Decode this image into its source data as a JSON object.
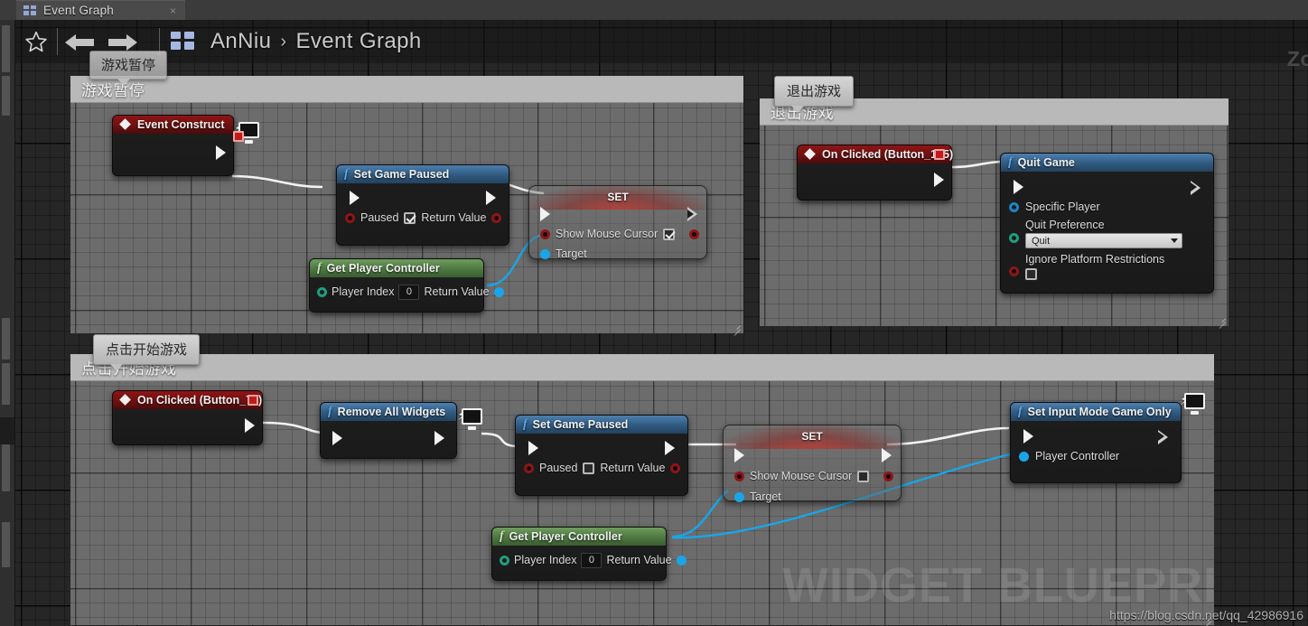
{
  "window": {
    "tab_label": "Event Graph",
    "tab_close": "×",
    "tab_icon": "graph-icon"
  },
  "toolbar": {
    "star_icon": "favorite-star-icon",
    "back_icon": "back-arrow-icon",
    "forward_icon": "forward-arrow-icon",
    "graph_icon": "event-graph-icon",
    "breadcrumb_root": "AnNiu",
    "breadcrumb_chevron": "›",
    "breadcrumb_leaf": "Event Graph",
    "zoom_label": "Zo"
  },
  "tooltips": {
    "pause": "游戏暂停",
    "quit": "退出游戏",
    "start": "点击开始游戏"
  },
  "comments": {
    "pause": "游戏暂停",
    "quit": "退出游戏",
    "start": "点击开始游戏"
  },
  "nodes": {
    "event_construct": {
      "title": "Event Construct",
      "icon": "event-diamond-icon",
      "badge": "monitor-icon",
      "exec_out": "exec-output-pin"
    },
    "set_game_paused_top": {
      "title": "Set Game Paused",
      "icon": "function-f-icon",
      "input_label": "Paused",
      "input_checked": true,
      "output_label": "Return Value"
    },
    "set_top": {
      "title": "SET",
      "input_label": "Show Mouse Cursor",
      "input_checked": true,
      "target_label": "Target"
    },
    "get_player_controller_top": {
      "title": "Get Player Controller",
      "icon": "function-f-icon",
      "input_label": "Player Index",
      "input_value": "0",
      "output_label": "Return Value"
    },
    "on_clicked_155": {
      "title": "On Clicked (Button_155)",
      "icon": "event-diamond-icon"
    },
    "quit_game": {
      "title": "Quit Game",
      "icon": "function-f-icon",
      "specific_player": "Specific Player",
      "quit_preference_label": "Quit Preference",
      "quit_preference_value": "Quit",
      "ignore_label": "Ignore Platform Restrictions",
      "ignore_checked": false
    },
    "on_clicked_77": {
      "title": "On Clicked (Button_77)",
      "icon": "event-diamond-icon"
    },
    "remove_all_widgets": {
      "title": "Remove All Widgets",
      "icon": "function-f-icon",
      "badge": "monitor-icon"
    },
    "set_game_paused_bottom": {
      "title": "Set Game Paused",
      "icon": "function-f-icon",
      "input_label": "Paused",
      "input_checked": false,
      "output_label": "Return Value"
    },
    "set_bottom": {
      "title": "SET",
      "input_label": "Show Mouse Cursor",
      "input_checked": false,
      "target_label": "Target"
    },
    "get_player_controller_bottom": {
      "title": "Get Player Controller",
      "icon": "function-f-icon",
      "input_label": "Player Index",
      "input_value": "0",
      "output_label": "Return Value"
    },
    "set_input_mode": {
      "title": "Set Input Mode Game Only",
      "icon": "function-f-icon",
      "badge": "monitor-icon",
      "player_controller_label": "Player Controller"
    }
  },
  "overlay": {
    "watermark": "WIDGET BLUEPRI",
    "url": "https://blog.csdn.net/qq_42986916"
  },
  "colors": {
    "event_red": "#8e1414",
    "function_blue": "#4d7fae",
    "pure_green": "#6f9c5e",
    "exec_wire": "#f2f2f2",
    "object_wire": "#19a6e8",
    "canvas_bg": "#262626",
    "comment_bg": "#6c6c6c",
    "comment_head": "#b9b9b9"
  }
}
